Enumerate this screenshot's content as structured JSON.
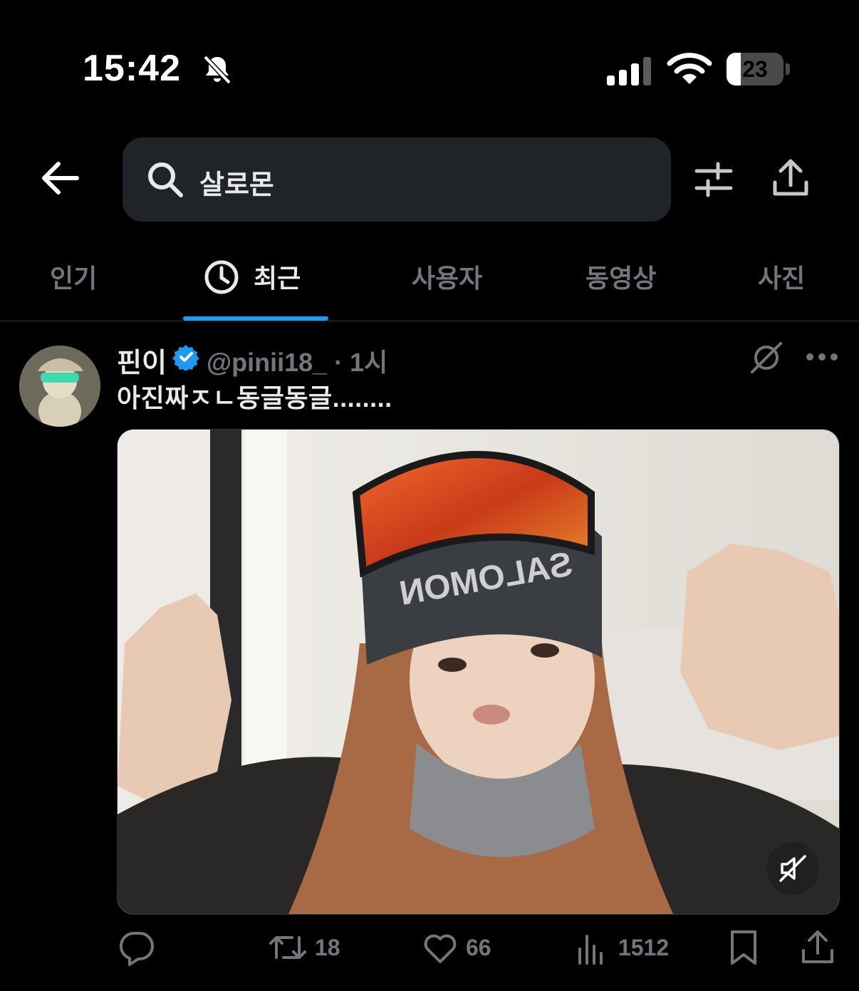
{
  "status_bar": {
    "time": "15:42",
    "battery": "23",
    "icons": [
      "bell-slash-icon",
      "signal-icon",
      "wifi-icon",
      "battery-icon"
    ]
  },
  "header": {
    "search_query": "살로몬",
    "icons": [
      "back-arrow-icon",
      "search-icon",
      "filter-icon",
      "share-icon"
    ]
  },
  "tabs": [
    {
      "label": "인기",
      "active": false
    },
    {
      "label": "최근",
      "active": true
    },
    {
      "label": "사용자",
      "active": false
    },
    {
      "label": "동영상",
      "active": false
    },
    {
      "label": "사진",
      "active": false
    }
  ],
  "tweet": {
    "name": "핀이",
    "handle_time": "@pinii18_ · 1시",
    "text": "아진짜ㅈㄴ동글동글........",
    "media_label": "SALOMON",
    "actions": {
      "replies": "",
      "retweets": "18",
      "likes": "66",
      "views": "1512"
    }
  },
  "colors": {
    "background": "#000000",
    "accent": "#1d9bf0",
    "muted": "#71767b",
    "text": "#e7e9ea",
    "search_bg": "#202327"
  }
}
